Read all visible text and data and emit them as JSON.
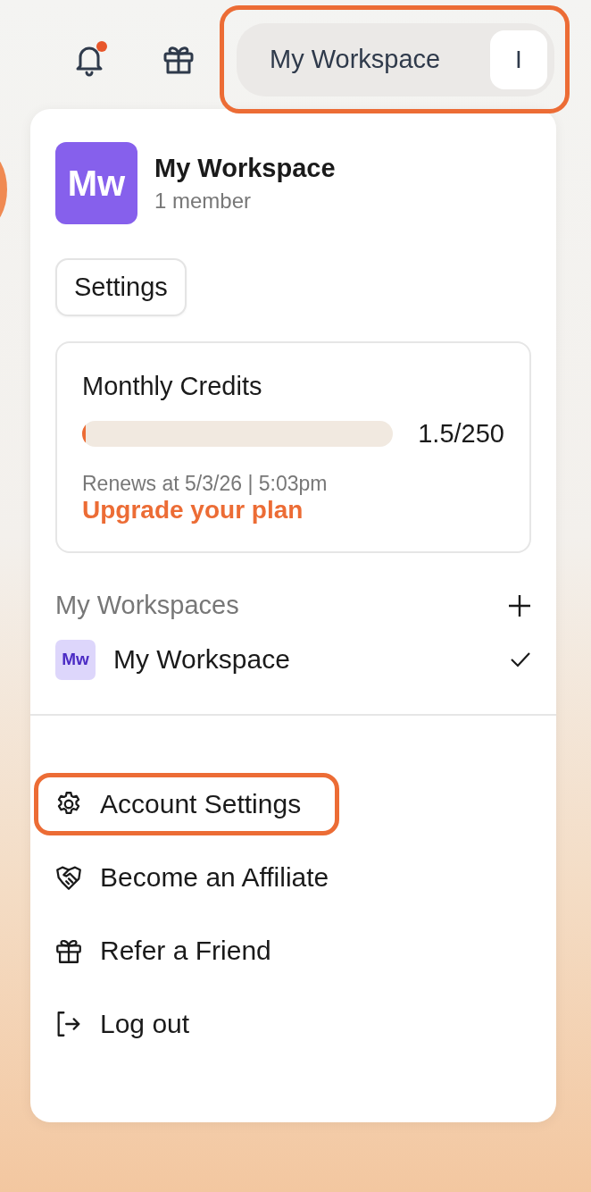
{
  "topbar": {
    "notifications": {
      "unread": true
    },
    "workspace_button": {
      "label": "My Workspace",
      "avatar": "I",
      "highlighted": true
    }
  },
  "menu": {
    "workspace": {
      "avatar": "Mw",
      "name": "My Workspace",
      "members": "1 member"
    },
    "settings_button": "Settings",
    "credits": {
      "title": "Monthly Credits",
      "level": 0.006,
      "reading": "1.5/250",
      "renews": "Renews at 5/3/26 | 5:03pm",
      "upgrade": "Upgrade your plan"
    },
    "workspaces": {
      "title": "My Workspaces",
      "items": [
        {
          "avatar": "Mw",
          "name": "My Workspace",
          "selected": true
        }
      ]
    },
    "items": [
      {
        "kind": "settings",
        "label": "Account Settings",
        "highlighted": true
      },
      {
        "kind": "affiliate",
        "label": "Become an Affiliate",
        "highlighted": false
      },
      {
        "kind": "gift",
        "label": "Refer a Friend",
        "highlighted": false
      },
      {
        "kind": "logout",
        "label": "Log out",
        "highlighted": false
      }
    ]
  }
}
